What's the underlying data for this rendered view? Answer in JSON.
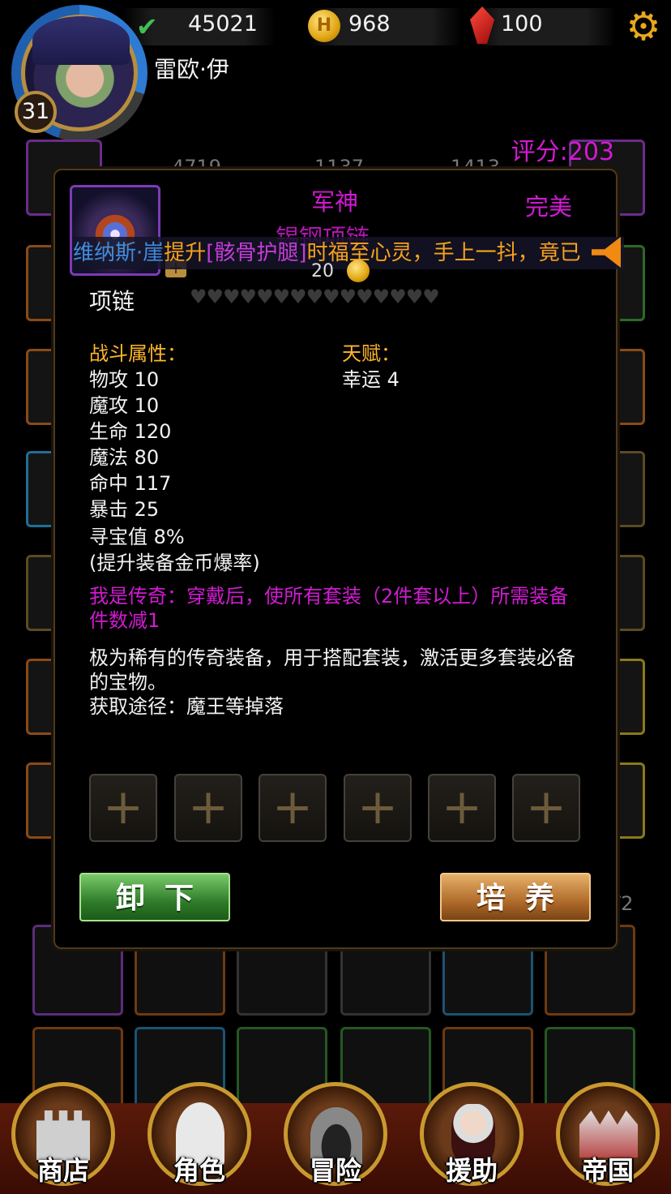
{
  "hud": {
    "exp": "45021",
    "coins": "968",
    "gems": "100",
    "coin_symbol": "H",
    "player_name": "雷欧·伊",
    "level": "31",
    "score": "评分:203"
  },
  "background": {
    "stats": [
      "4719",
      "1137",
      "1413"
    ],
    "page": "/2"
  },
  "item": {
    "title_line1": "军神",
    "title_line2": "锡钢项链",
    "quality": "完美",
    "enhance_cost": "20",
    "slot_type": "项链",
    "hearts": "♥♥♥♥♥♥♥♥♥♥♥♥♥♥♥",
    "combat_title": "战斗属性：",
    "combat_stats": [
      "物攻 10",
      "魔攻 10",
      "生命 120",
      "魔法 80",
      "命中 117",
      "暴击 25",
      "寻宝值 8%",
      "(提升装备金币爆率)"
    ],
    "talent_title": "天赋：",
    "talents": [
      "幸运 4"
    ],
    "set_effect": "我是传奇：穿戴后，使所有套装（2件套以上）所需装备件数减1",
    "description": "极为稀有的传奇装备，用于搭配套装，激活更多套装必备的宝物。",
    "source": "获取途径：魔王等掉落",
    "sockets": [
      "+",
      "+",
      "+",
      "+",
      "+",
      "+"
    ],
    "unequip_label": "卸下",
    "train_label": "培养"
  },
  "marquee": {
    "name": "维纳斯·崖",
    "verb": "提升",
    "item": "[骸骨护腿]",
    "text": "时福至心灵，手上一抖，竟已"
  },
  "nav": [
    {
      "label": "商店"
    },
    {
      "label": "角色"
    },
    {
      "label": "冒险"
    },
    {
      "label": "援助"
    },
    {
      "label": "帝国"
    }
  ],
  "colors": {
    "legendary": "#d21ad2",
    "section": "#ffb52b",
    "accent_gold": "#c9992f"
  },
  "icons": [
    "check-icon",
    "coin-icon",
    "gem-icon",
    "gear-icon",
    "horn-icon",
    "heart-icon",
    "plus-icon"
  ]
}
